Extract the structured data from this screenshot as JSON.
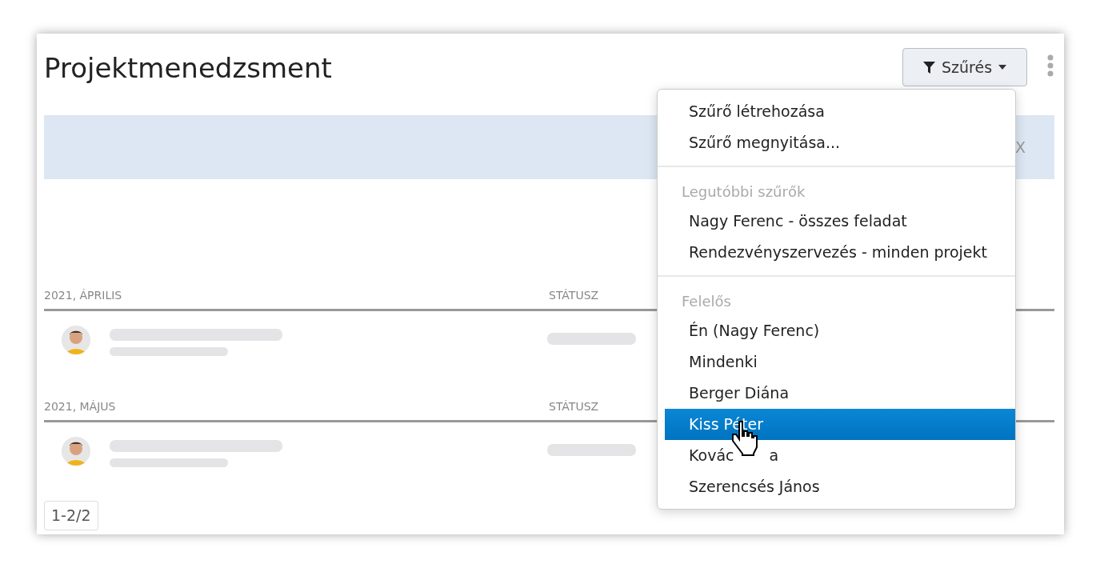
{
  "title": "Projektmenedzsment",
  "filter_button": {
    "label": "Szűrés"
  },
  "banner": {
    "close": "X"
  },
  "groups": [
    {
      "heading": "2021, ÁPRILIS",
      "status_heading": "STÁTUSZ",
      "rows": [
        {
          "kind": "placeholder"
        }
      ]
    },
    {
      "heading": "2021, MÁJUS",
      "status_heading": "STÁTUSZ",
      "rows": [
        {
          "kind": "placeholder"
        }
      ]
    }
  ],
  "pager": "1-2/2",
  "dropdown": {
    "sections": [
      {
        "items": [
          {
            "label": "Szűrő létrehozása",
            "selected": false
          },
          {
            "label": "Szűrő megnyitása...",
            "selected": false
          }
        ]
      },
      {
        "heading": "Legutóbbi szűrők",
        "items": [
          {
            "label": "Nagy Ferenc - összes feladat",
            "selected": false
          },
          {
            "label": "Rendezvényszervezés - minden projekt",
            "selected": false
          }
        ]
      },
      {
        "heading": "Felelős",
        "items": [
          {
            "label": "Én (Nagy Ferenc)",
            "selected": false
          },
          {
            "label": "Mindenki",
            "selected": false
          },
          {
            "label": "Berger Diána",
            "selected": false
          },
          {
            "label": "Kiss Péter",
            "selected": true
          },
          {
            "label": "Kovác",
            "label_after_cursor": "a",
            "selected": false
          },
          {
            "label": "Szerencsés János",
            "selected": false
          }
        ]
      }
    ]
  }
}
